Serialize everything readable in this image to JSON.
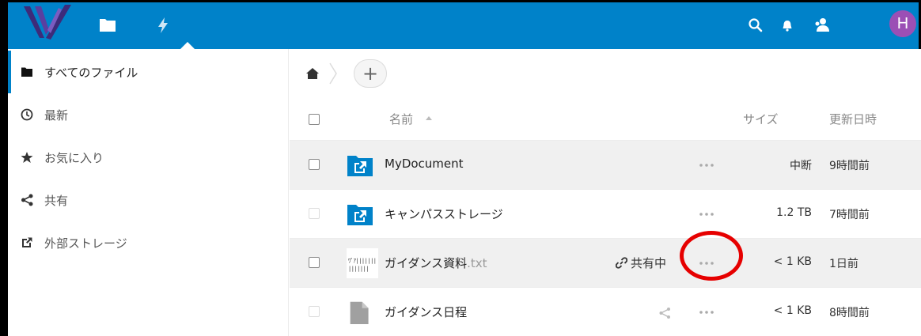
{
  "header": {
    "avatar_letter": "H",
    "icons": [
      "app-logo",
      "files-icon",
      "activity-icon",
      "search-icon",
      "bell-icon",
      "contacts-icon"
    ]
  },
  "sidebar": {
    "items": [
      {
        "label": "すべてのファイル",
        "icon": "folder-icon",
        "active": true
      },
      {
        "label": "最新",
        "icon": "clock-icon",
        "active": false
      },
      {
        "label": "お気に入り",
        "icon": "star-icon",
        "active": false
      },
      {
        "label": "共有",
        "icon": "share-icon",
        "active": false
      },
      {
        "label": "外部ストレージ",
        "icon": "external-link-icon",
        "active": false
      }
    ]
  },
  "breadcrumb": {
    "add_label": "+"
  },
  "table": {
    "columns": {
      "name": "名前",
      "size": "サイズ",
      "modified": "更新日時"
    },
    "rows": [
      {
        "name": "MyDocument",
        "ext": "",
        "size": "中断",
        "modified": "9時間前",
        "icon": "external-folder-icon"
      },
      {
        "name": "キャンパスストレージ",
        "ext": "",
        "size": "1.2 TB",
        "modified": "7時間前",
        "icon": "external-folder-icon"
      },
      {
        "name": "ガイダンス資料",
        "ext": ".txt",
        "size": "< 1 KB",
        "modified": "1日前",
        "icon": "text-thumbnail",
        "shared_label": "共有中",
        "thumb_lines": [
          "ﾜﾟｱ|||||||",
          "|||||||"
        ]
      },
      {
        "name": "ガイダンス日程",
        "ext": "",
        "size": "< 1 KB",
        "modified": "8時間前",
        "icon": "file-icon"
      }
    ]
  },
  "colors": {
    "header": "#0082c9",
    "avatar": "#9b4fb5",
    "folder": "#0082c9",
    "highlight_ring": "#e60000"
  }
}
